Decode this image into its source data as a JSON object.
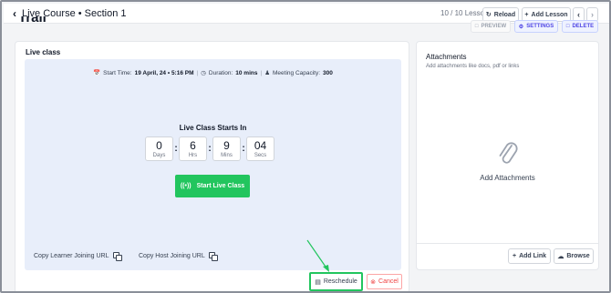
{
  "topbar": {
    "breadcrumb": "Live Course • Section 1",
    "counter": "10 / 10 Lesson",
    "reload_label": "Reload",
    "add_lesson_label": "Add Lesson"
  },
  "lesson": {
    "title": "Trail",
    "preview_label": "PREVIEW",
    "settings_label": "SETTINGS",
    "delete_label": "DELETE"
  },
  "live_class": {
    "section_title": "Live class",
    "start_time_label": "Start Time:",
    "start_time_value": "19 April, 24 • 5:16 PM",
    "duration_label": "Duration:",
    "duration_value": "10 mins",
    "capacity_label": "Meeting Capacity:",
    "capacity_value": "300",
    "starts_in_label": "Live Class Starts In",
    "countdown": [
      {
        "value": "0",
        "unit": "Days"
      },
      {
        "value": "6",
        "unit": "Hrs"
      },
      {
        "value": "9",
        "unit": "Mins"
      },
      {
        "value": "04",
        "unit": "Secs"
      }
    ],
    "start_button_label": "Start Live Class",
    "copy_learner_label": "Copy Learner Joining URL",
    "copy_host_label": "Copy Host Joining URL",
    "reschedule_label": "Reschedule",
    "cancel_label": "Cancel"
  },
  "attachments": {
    "title": "Attachments",
    "subtitle": "Add attachments like docs, pdf or links",
    "empty_label": "Add Attachments",
    "add_link_label": "Add Link",
    "browse_label": "Browse"
  },
  "colors": {
    "accent_green": "#22c55e",
    "danger_red": "#ef4444",
    "panel_blue": "#e8eefa",
    "primary_indigo": "#4f46e5"
  }
}
